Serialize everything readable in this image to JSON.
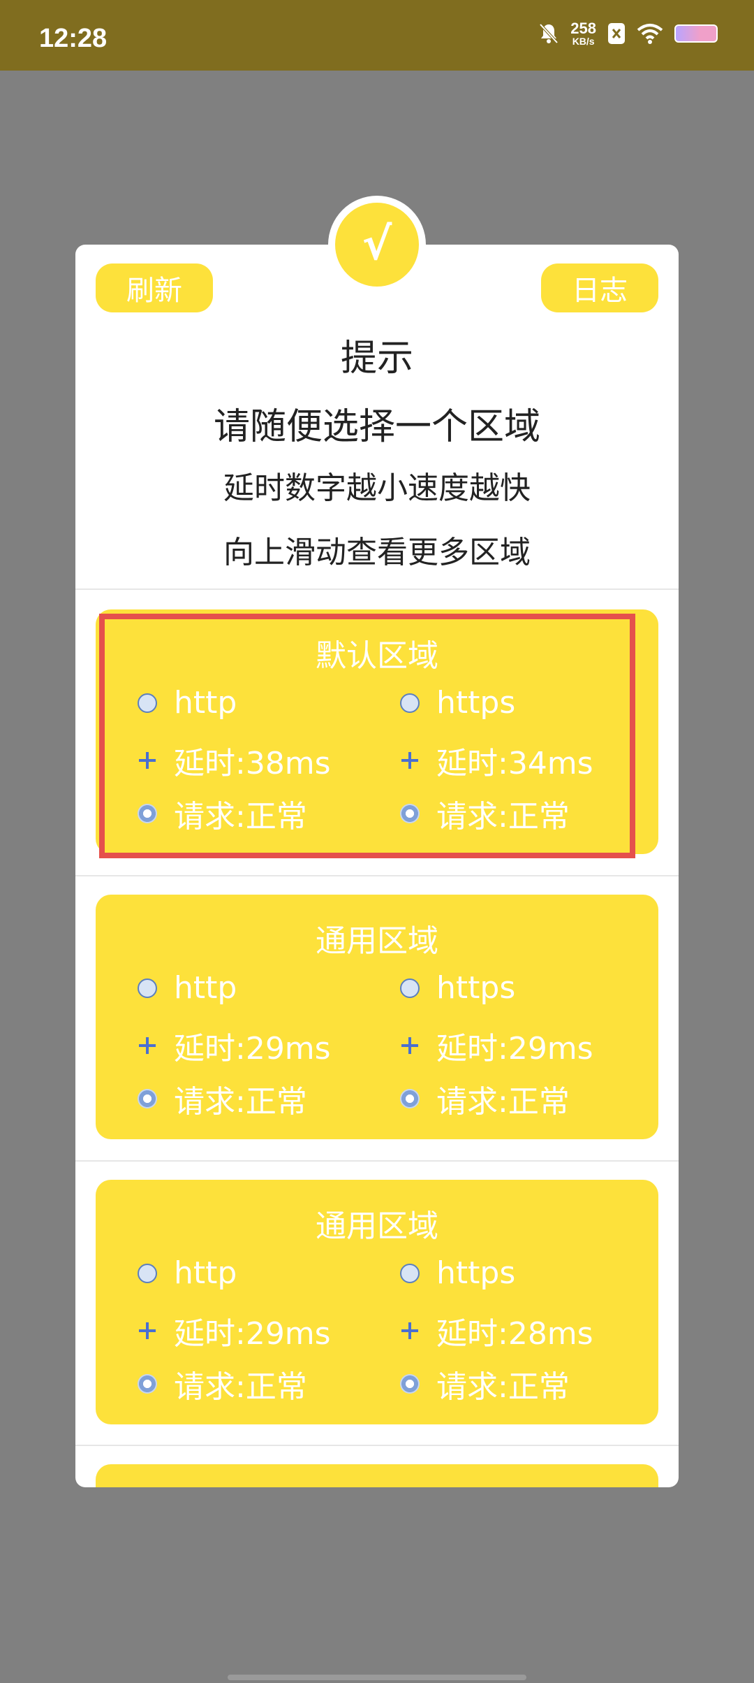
{
  "status_bar": {
    "time": "12:28",
    "net_speed": "258",
    "net_unit": "KB/s",
    "icons": [
      "bell-off-icon",
      "x-badge-icon",
      "wifi-icon",
      "battery-icon"
    ]
  },
  "dialog": {
    "check_symbol": "√",
    "refresh_label": "刷新",
    "log_label": "日志",
    "title": "提示",
    "line1": "请随便选择一个区域",
    "line2": "延时数字越小速度越快",
    "line3": "向上滑动查看更多区域"
  },
  "regions": [
    {
      "name": "默认区域",
      "left": {
        "protocol": "http",
        "delay": "延时:38ms",
        "status": "请求:正常"
      },
      "right": {
        "protocol": "https",
        "delay": "延时:34ms",
        "status": "请求:正常"
      }
    },
    {
      "name": "通用区域",
      "left": {
        "protocol": "http",
        "delay": "延时:29ms",
        "status": "请求:正常"
      },
      "right": {
        "protocol": "https",
        "delay": "延时:29ms",
        "status": "请求:正常"
      }
    },
    {
      "name": "通用区域",
      "left": {
        "protocol": "http",
        "delay": "延时:29ms",
        "status": "请求:正常"
      },
      "right": {
        "protocol": "https",
        "delay": "延时:28ms",
        "status": "请求:正常"
      }
    }
  ],
  "colors": {
    "accent": "#fde13b",
    "status_bar": "#806d1f",
    "overlay": "#808080",
    "highlight": "#e5504c"
  }
}
